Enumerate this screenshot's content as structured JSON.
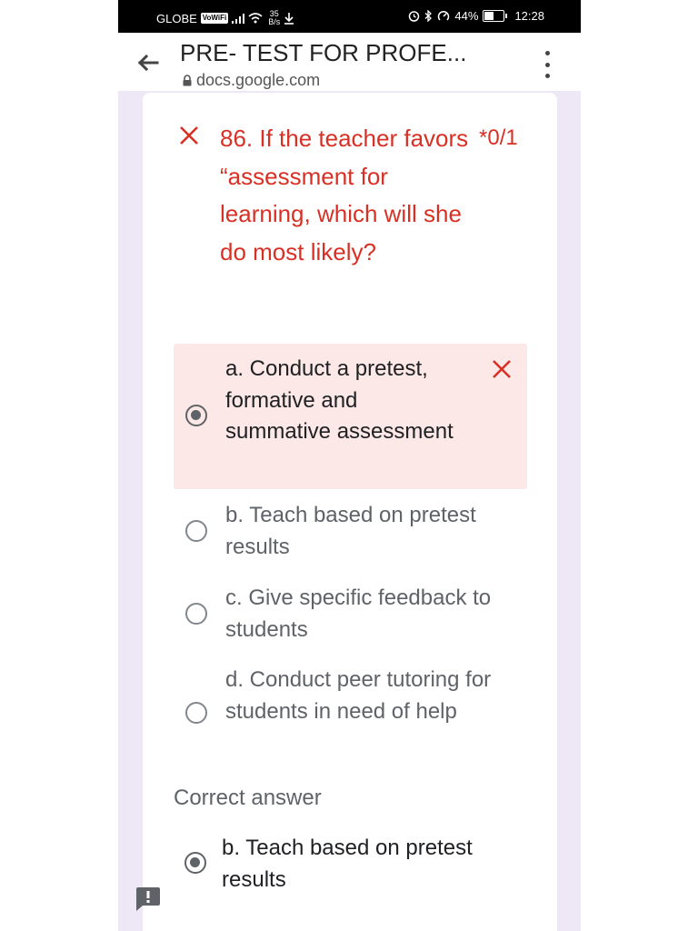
{
  "status_bar": {
    "carrier": "GLOBE",
    "vowifi": "VoWiFi",
    "net_speed_value": "35",
    "net_speed_unit": "B/s",
    "battery": "44%",
    "time": "12:28",
    "battery_level": 0.44
  },
  "header": {
    "title": "PRE- TEST FOR PROFE...",
    "url": "docs.google.com"
  },
  "question": {
    "text": "86. If the teacher favors “assessment for learning, which will she do most likely?",
    "score": "*0/1",
    "status": "incorrect"
  },
  "options": [
    {
      "label": "a. Conduct a pretest, formative and summative assessment",
      "selected": true,
      "marked": "wrong"
    },
    {
      "label": "b. Teach based on pretest results",
      "selected": false
    },
    {
      "label": "c. Give specific feedback to students",
      "selected": false
    },
    {
      "label": "d. Conduct peer tutoring for students in need of help",
      "selected": false
    }
  ],
  "correct_answer": {
    "heading": "Correct answer",
    "label": "b. Teach based on pretest results"
  },
  "colors": {
    "error_red": "#d93025",
    "wrong_bg": "#fce8e6",
    "page_bg": "#ede7f6"
  },
  "icons": [
    "back-arrow-icon",
    "lock-icon",
    "more-vert-icon",
    "close-icon",
    "radio-button-icon",
    "feedback-icon",
    "wifi-icon",
    "signal-icon",
    "download-icon",
    "alarm-icon",
    "bluetooth-icon",
    "battery-icon"
  ]
}
